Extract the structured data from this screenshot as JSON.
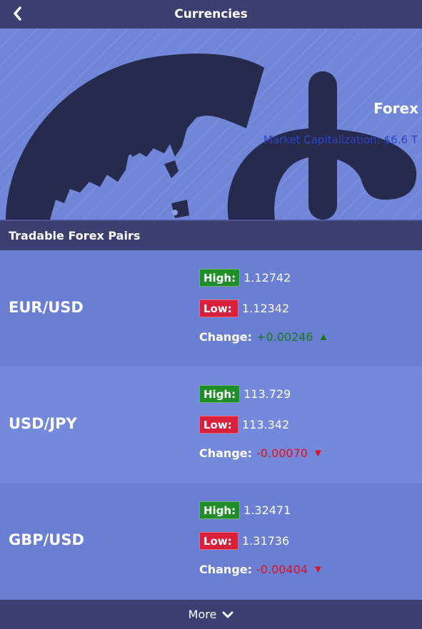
{
  "header": {
    "title": "Currencies",
    "back_icon": "chevron-left-icon"
  },
  "hero": {
    "name": "Forex",
    "market_cap_label": "Market Capitalization:",
    "market_cap_value": "$6.6 T"
  },
  "section": {
    "title": "Tradable Forex Pairs"
  },
  "labels": {
    "high": "High:",
    "low": "Low:",
    "change": "Change:"
  },
  "pairs": [
    {
      "symbol": "EUR/USD",
      "high": "1.12742",
      "low": "1.12342",
      "change": "+0.00246",
      "direction": "up",
      "arrow": "▲"
    },
    {
      "symbol": "USD/JPY",
      "high": "113.729",
      "low": "113.342",
      "change": "-0.00070",
      "direction": "down",
      "arrow": "▼"
    },
    {
      "symbol": "GBP/USD",
      "high": "1.32471",
      "low": "1.31736",
      "change": "-0.00404",
      "direction": "down",
      "arrow": "▼"
    }
  ],
  "footer": {
    "more_label": "More",
    "more_icon": "chevron-down-icon"
  },
  "colors": {
    "header": "#3b4070",
    "hero": "#7186d8",
    "high": "#1f8e29",
    "low": "#d8203a",
    "up": "#157a1a",
    "down": "#d81423",
    "art": "#262b4d"
  }
}
